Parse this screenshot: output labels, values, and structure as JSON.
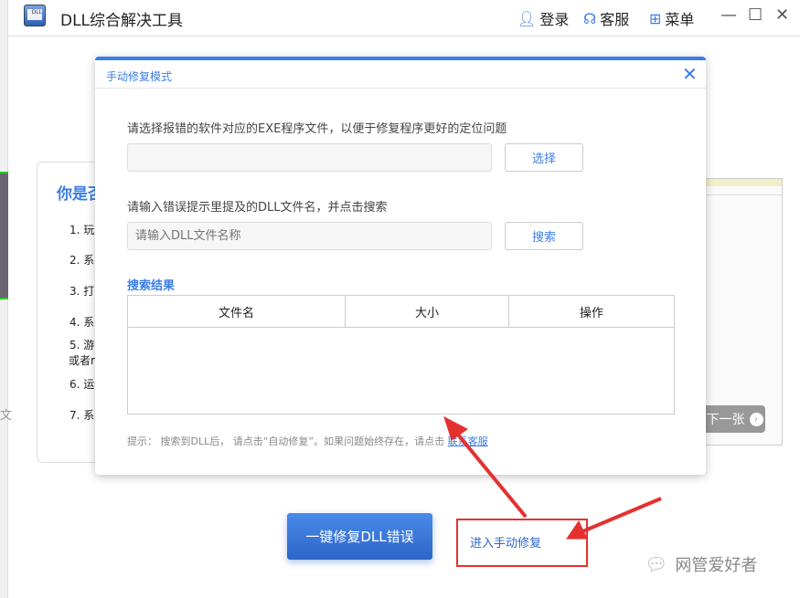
{
  "app": {
    "title": "DLL综合解决工具",
    "login": "登录",
    "service": "客服",
    "menu": "菜单"
  },
  "background": {
    "card_title": "你是否",
    "items": [
      "1. 玩",
      "2. 系",
      "3. 打",
      "4. 系",
      "5. 游",
      "或者r",
      "6. 运",
      "7. 系"
    ],
    "next_label": "下一张",
    "left_char": "文"
  },
  "modal": {
    "title": "手动修复模式",
    "exe_label": "请选择报错的软件对应的EXE程序文件，以便于修复程序更好的定位问题",
    "exe_value": "",
    "choose_button": "选择",
    "dll_label": "请输入错误提示里提及的DLL文件名，并点击搜索",
    "dll_placeholder": "请输入DLL文件名称",
    "search_button": "搜索",
    "results_title": "搜索结果",
    "columns": [
      "文件名",
      "大小",
      "操作"
    ],
    "hint": "提示： 搜索到DLL后， 请点击“自动修复”。如果问题始终存在，请点击",
    "contact_link": "联系客服"
  },
  "footer": {
    "repair_button": "一键修复DLL错误",
    "manual_link": "进入手动修复"
  },
  "watermark": "网管爱好者",
  "colors": {
    "accent": "#3a7ee8",
    "annotation": "#e53030"
  }
}
